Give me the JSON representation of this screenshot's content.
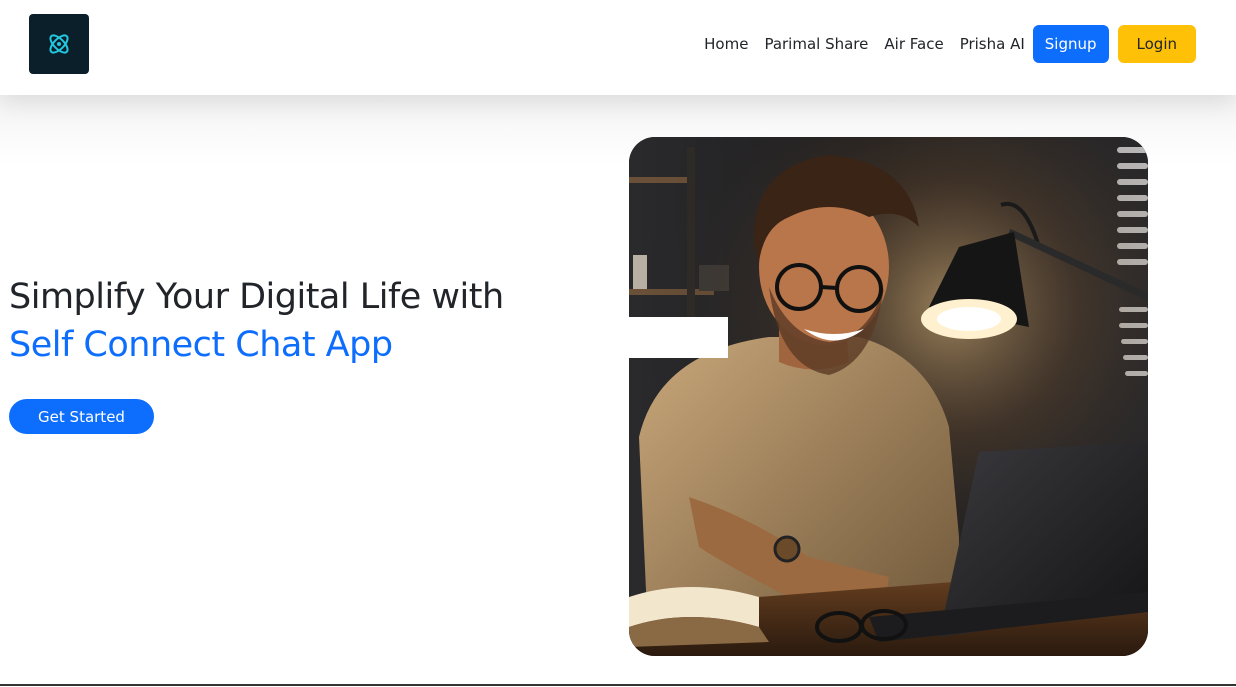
{
  "navbar": {
    "logo_icon": "atom-icon",
    "links": [
      "Home",
      "Parimal Share",
      "Air Face",
      "Prisha AI"
    ],
    "signup_label": "Signup",
    "login_label": "Login"
  },
  "hero": {
    "title_line1": "Simplify Your Digital Life with",
    "title_line2": "Self Connect Chat App",
    "cta_label": "Get Started",
    "image_subject": "smiling man with glasses working on laptop under desk lamp"
  },
  "colors": {
    "primary": "#0d6efd",
    "warning": "#ffc107",
    "logo_bg": "#0b1f2a",
    "text": "#212529"
  }
}
